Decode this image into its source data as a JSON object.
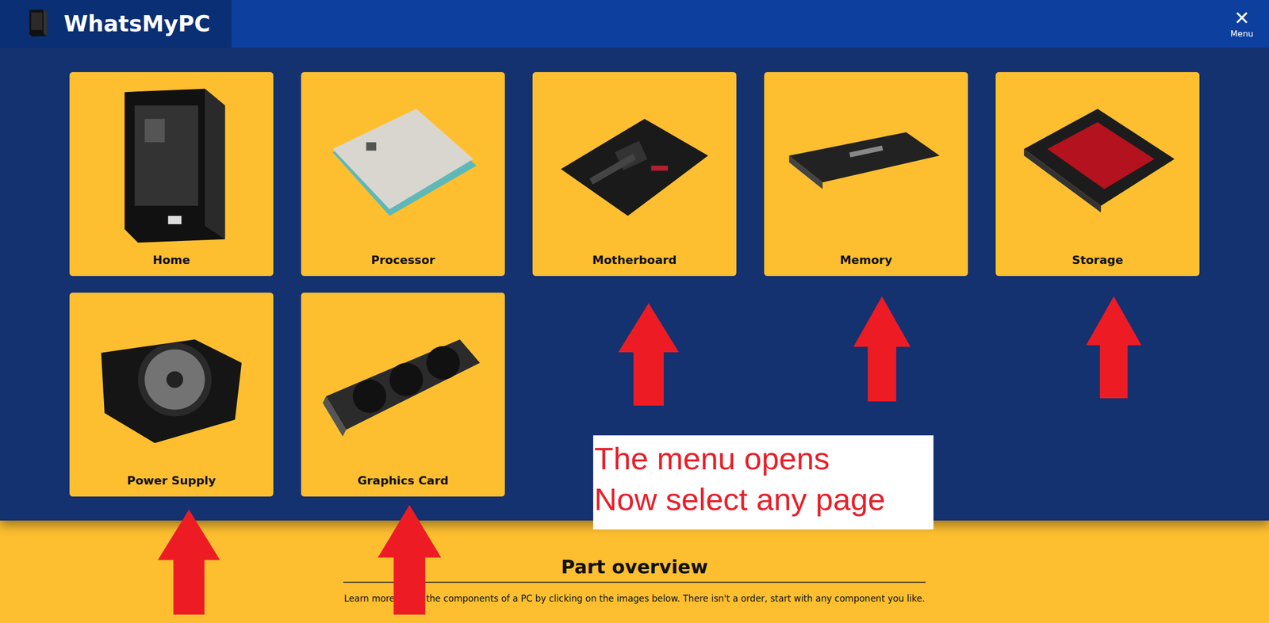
{
  "header": {
    "title": "WhatsMyPC",
    "close": "✕",
    "menu_label": "Menu"
  },
  "menu": {
    "items": [
      {
        "label": "Home"
      },
      {
        "label": "Processor"
      },
      {
        "label": "Motherboard"
      },
      {
        "label": "Memory"
      },
      {
        "label": "Storage"
      },
      {
        "label": "Power Supply"
      },
      {
        "label": "Graphics Card"
      }
    ]
  },
  "annotation": {
    "lines": [
      "The menu opens",
      "Now select any page"
    ]
  },
  "section": {
    "title": "Part overview",
    "text": "Learn more about the components of a PC by clicking on the images below. There isn't a order, start with any component you like."
  }
}
